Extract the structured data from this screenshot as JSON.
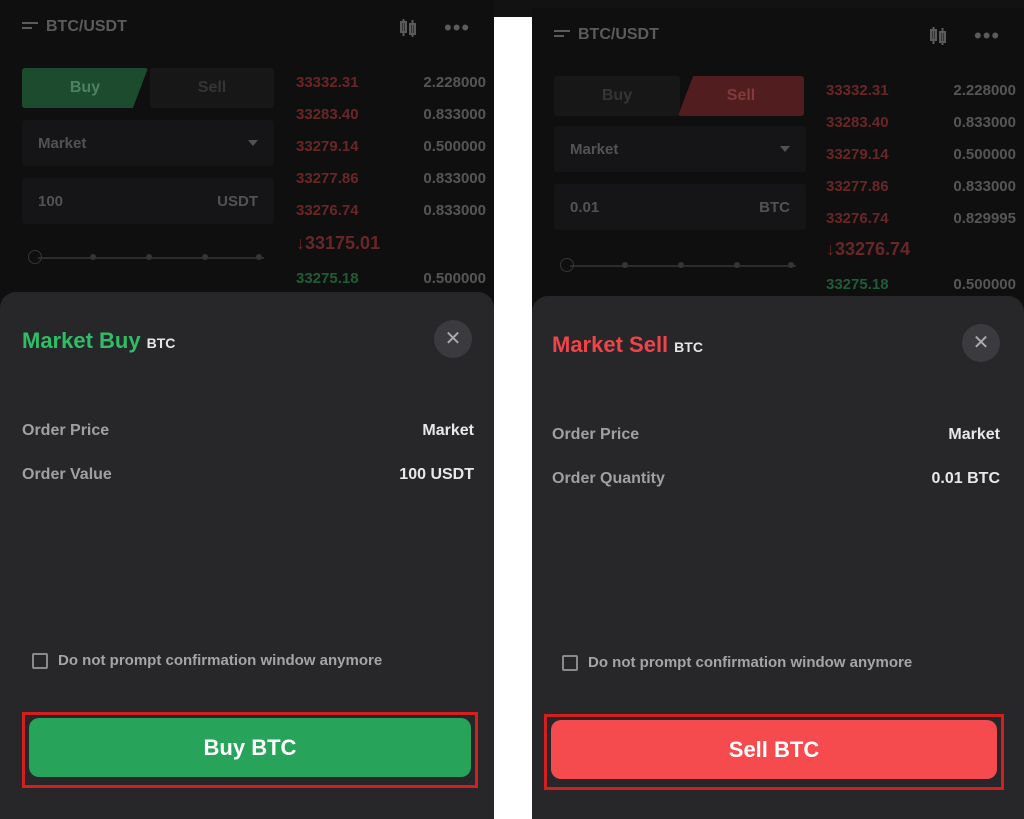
{
  "buy_screen": {
    "pair": "BTC/USDT",
    "tabs": {
      "buy": "Buy",
      "sell": "Sell"
    },
    "order_type": "Market",
    "amount": {
      "value": "100",
      "unit": "USDT"
    },
    "orderbook": {
      "asks": [
        {
          "price": "33332.31",
          "qty": "2.228000"
        },
        {
          "price": "33283.40",
          "qty": "0.833000"
        },
        {
          "price": "33279.14",
          "qty": "0.500000"
        },
        {
          "price": "33277.86",
          "qty": "0.833000"
        },
        {
          "price": "33276.74",
          "qty": "0.833000"
        }
      ],
      "last": "↓33175.01",
      "bids": [
        {
          "price": "33275.18",
          "qty": "0.500000"
        }
      ]
    },
    "dialog": {
      "title": "Market Buy",
      "title_sub": "BTC",
      "close": "✕",
      "rows": [
        {
          "label": "Order Price",
          "value": "Market"
        },
        {
          "label": "Order Value",
          "value": "100 USDT"
        }
      ],
      "checkbox": "Do not prompt confirmation window anymore",
      "button": "Buy BTC"
    }
  },
  "sell_screen": {
    "pair": "BTC/USDT",
    "tabs": {
      "buy": "Buy",
      "sell": "Sell"
    },
    "order_type": "Market",
    "amount": {
      "value": "0.01",
      "unit": "BTC"
    },
    "orderbook": {
      "asks": [
        {
          "price": "33332.31",
          "qty": "2.228000"
        },
        {
          "price": "33283.40",
          "qty": "0.833000"
        },
        {
          "price": "33279.14",
          "qty": "0.500000"
        },
        {
          "price": "33277.86",
          "qty": "0.833000"
        },
        {
          "price": "33276.74",
          "qty": "0.829995"
        }
      ],
      "last": "↓33276.74",
      "bids": [
        {
          "price": "33275.18",
          "qty": "0.500000"
        }
      ]
    },
    "dialog": {
      "title": "Market Sell",
      "title_sub": "BTC",
      "close": "✕",
      "rows": [
        {
          "label": "Order Price",
          "value": "Market"
        },
        {
          "label": "Order Quantity",
          "value": "0.01 BTC"
        }
      ],
      "checkbox": "Do not prompt confirmation window anymore",
      "button": "Sell BTC"
    }
  },
  "colors": {
    "buy_green": "#27a35a",
    "sell_red": "#f54b4f",
    "highlight_outline": "#d21f1f"
  }
}
